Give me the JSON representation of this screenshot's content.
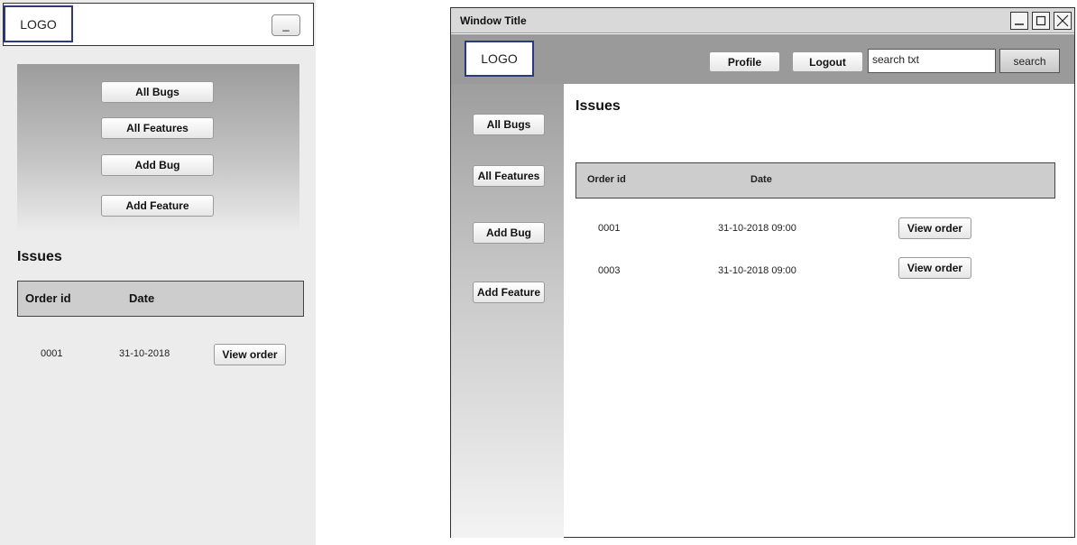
{
  "mobile": {
    "logo": "LOGO",
    "menu_button": "_",
    "nav": [
      "All Bugs",
      "All Features",
      "Add Bug",
      "Add Feature"
    ],
    "issues_title": "Issues",
    "table": {
      "headers": [
        "Order id",
        "Date"
      ],
      "rows": [
        {
          "id": "0001",
          "date": "31-10-2018",
          "action": "View order"
        }
      ]
    }
  },
  "desktop": {
    "window_title": "Window Title",
    "window_controls": [
      "minimize-icon",
      "maximize-icon",
      "close-icon"
    ],
    "logo": "LOGO",
    "topbar": {
      "profile": "Profile",
      "logout": "Logout",
      "search_value": "search txt",
      "search_button": "search"
    },
    "sidebar": [
      "All Bugs",
      "All Features",
      "Add Bug",
      "Add Feature"
    ],
    "issues_title": "Issues",
    "table": {
      "headers": [
        "Order id",
        "Date"
      ],
      "rows": [
        {
          "id": "0001",
          "date": "31-10-2018 09:00",
          "action": "View order"
        },
        {
          "id": "0003",
          "date": "31-10-2018 09:00",
          "action": "View order"
        }
      ]
    }
  }
}
